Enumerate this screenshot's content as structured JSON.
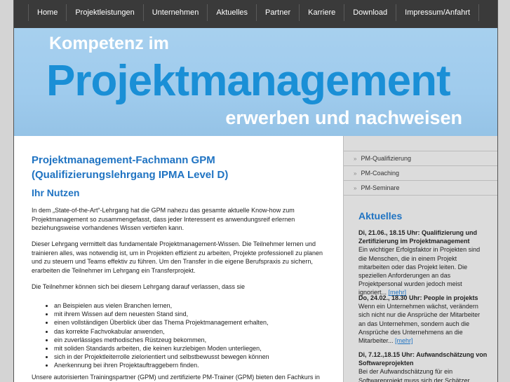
{
  "nav": [
    "Home",
    "Projektleistungen",
    "Unternehmen",
    "Aktuelles",
    "Partner",
    "Karriere",
    "Download",
    "Impressum/Anfahrt"
  ],
  "banner": {
    "line1": "Kompetenz im",
    "line2": "Projektmanagement",
    "line3": "erwerben und nachweisen"
  },
  "main": {
    "title": "Projektmanagement-Fachmann GPM (Qualifizierungslehrgang IPMA Level D)",
    "subtitle": "Ihr Nutzen",
    "p1": "In dem „State-of-the-Art“-Lehrgang hat die GPM nahezu das gesamte aktuelle Know-how zum Projektmanagement so zusammengefasst, dass jeder Interessent es anwendungsreif erlernen beziehungsweise vorhandenes Wissen vertiefen kann.",
    "p2": "Dieser Lehrgang vermittelt das fundamentale Projektmanagement-Wissen. Die Teilnehmer lernen und trainieren alles, was notwendig ist, um in Projekten effizient zu arbeiten, Projekte professionell zu planen und zu steuern und Teams effektiv zu führen. Um den Transfer in die eigene Berufspraxis zu sichern, erarbeiten die Teilnehmer im Lehrgang ein Transferprojekt.",
    "p3": "Die Teilnehmer können sich bei diesem Lehrgang darauf verlassen, dass sie",
    "bullets": [
      "an Beispielen aus vielen Branchen lernen,",
      "mit ihrem Wissen auf dem neuesten Stand sind,",
      "einen vollständigen Überblick über das Thema Projektmanagement erhalten,",
      "das korrekte Fachvokabular anwenden,",
      "ein zuverlässiges methodisches Rüstzeug bekommen,",
      "mit soliden Standards arbeiten, die keinen kurzlebigen Moden unterliegen,",
      "sich in der Projektleiterrolle zielorientiert und selbstbewusst bewegen können",
      "Anerkennung bei ihren Projektauftraggebern finden."
    ],
    "p4": "Unsere autorisierten Trainingspartner (GPM) und zertifizierte PM-Trainer (GPM) bieten den Fachkurs in"
  },
  "sidebar": {
    "links": [
      "PM-Qualifizierung",
      "PM-Coaching",
      "PM-Seminare"
    ],
    "news_title": "Aktuelles",
    "news": [
      {
        "head": "Di, 21.06., 18.15 Uhr: Qualifizierung und Zertifizierung im Projektmanagement",
        "text": "Ein wichtiger Erfolgsfaktor in Projekten sind die Menschen, die in einem Projekt mitarbeiten oder das Projekt leiten. Die speziellen Anforderungen an das Projektpersonal wurden jedoch meist ignoriert...",
        "more": "[mehr]"
      },
      {
        "head": "Do, 24.02., 18.30 Uhr: People in projekts",
        "text": "Wenn ein Unternehmen wächst, verändern sich nicht nur die Ansprüche der Mitarbeiter an das Unternehmen, sondern auch die Ansprüche des Unternehmens an die Mitarbeiter...",
        "more": "[mehr]"
      },
      {
        "head": "Di, 7.12.,18.15 Uhr: Aufwandschätzung von Softwareprojekten",
        "text": "Bei der Aufwandschätzung für ein Softwareprojekt muss sich der Schätzer",
        "more": ""
      }
    ]
  }
}
